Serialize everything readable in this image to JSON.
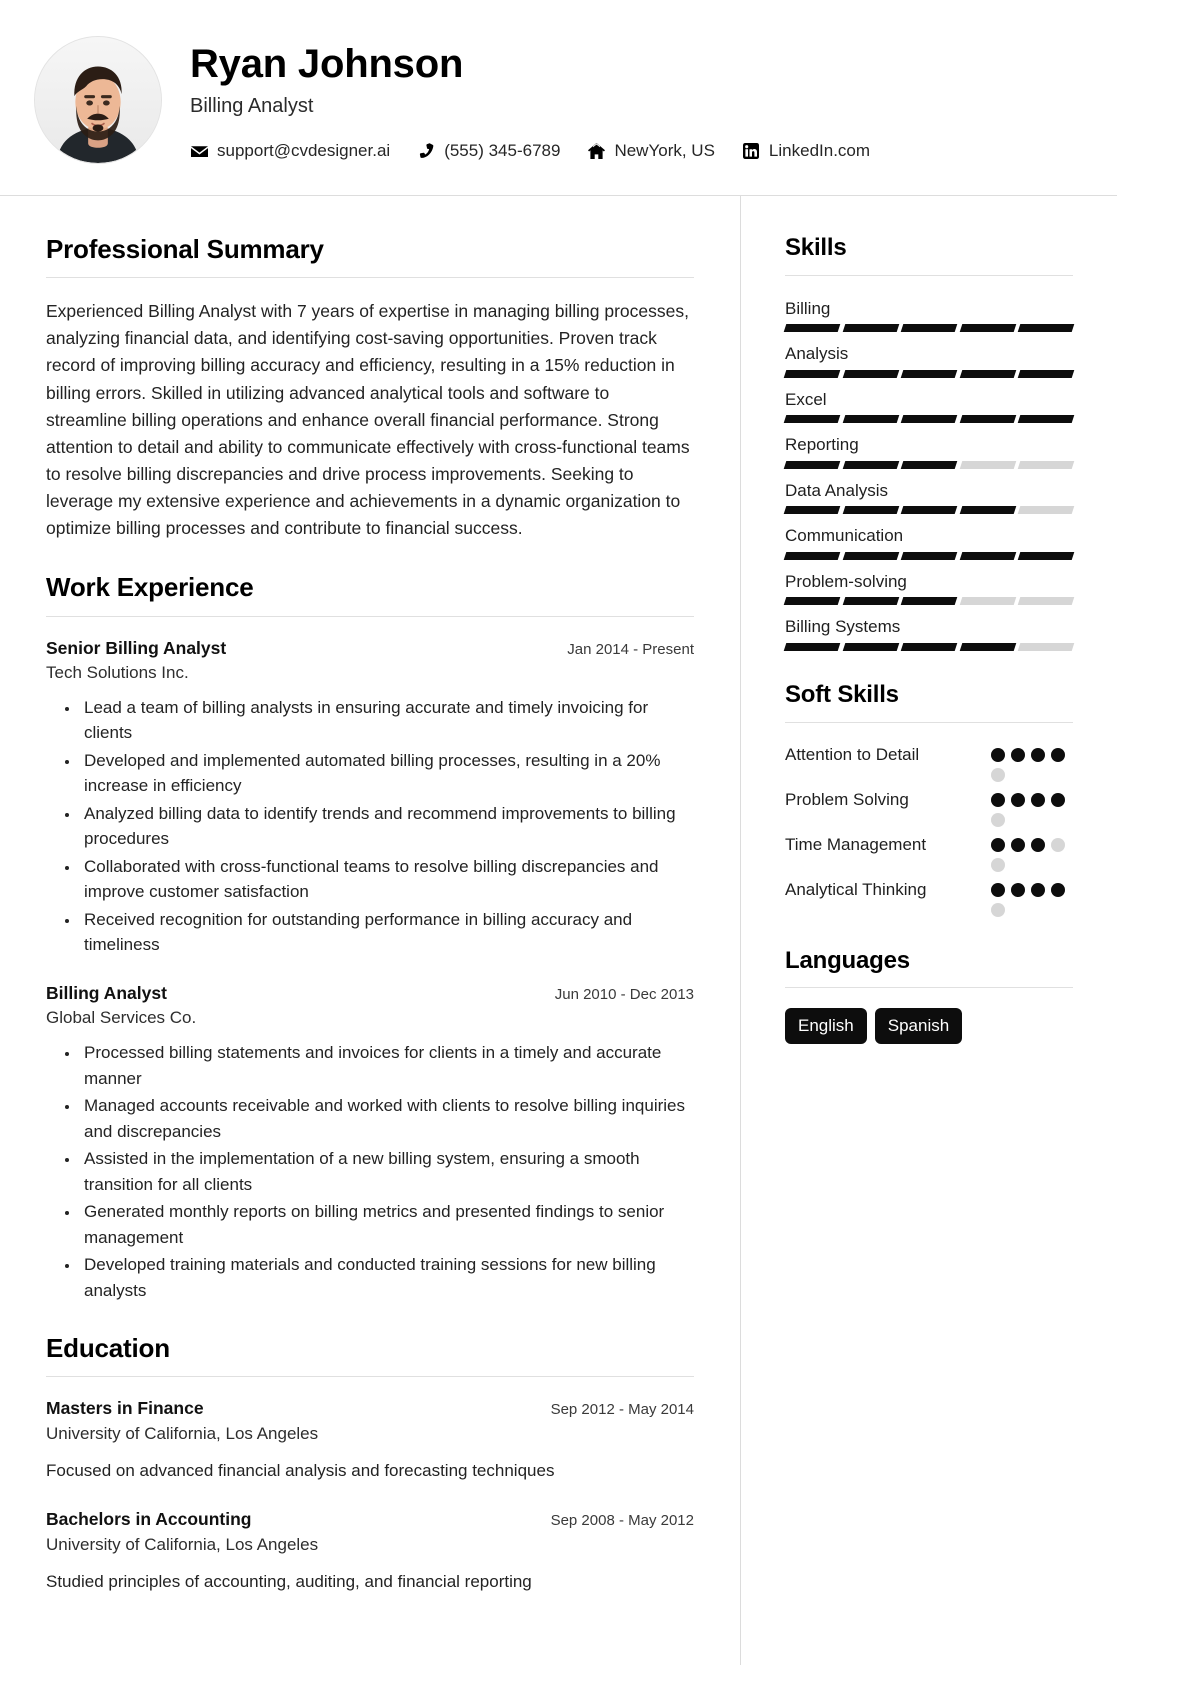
{
  "header": {
    "name": "Ryan Johnson",
    "title": "Billing Analyst",
    "avatar_name": "profile-photo",
    "contacts": [
      {
        "icon": "email-icon",
        "value": "support@cvdesigner.ai"
      },
      {
        "icon": "phone-icon",
        "value": "(555) 345-6789"
      },
      {
        "icon": "home-icon",
        "value": "NewYork, US"
      },
      {
        "icon": "linkedin-icon",
        "value": "LinkedIn.com"
      }
    ]
  },
  "summary": {
    "title": "Professional Summary",
    "text": "Experienced Billing Analyst with 7 years of expertise in managing billing processes, analyzing financial data, and identifying cost-saving opportunities. Proven track record of improving billing accuracy and efficiency, resulting in a 15% reduction in billing errors. Skilled in utilizing advanced analytical tools and software to streamline billing operations and enhance overall financial performance. Strong attention to detail and ability to communicate effectively with cross-functional teams to resolve billing discrepancies and drive process improvements. Seeking to leverage my extensive experience and achievements in a dynamic organization to optimize billing processes and contribute to financial success."
  },
  "experience": {
    "title": "Work Experience",
    "entries": [
      {
        "role": "Senior Billing Analyst",
        "dates": "Jan 2014 - Present",
        "org": "Tech Solutions Inc.",
        "bullets": [
          "Lead a team of billing analysts in ensuring accurate and timely invoicing for clients",
          "Developed and implemented automated billing processes, resulting in a 20% increase in efficiency",
          "Analyzed billing data to identify trends and recommend improvements to billing procedures",
          "Collaborated with cross-functional teams to resolve billing discrepancies and improve customer satisfaction",
          "Received recognition for outstanding performance in billing accuracy and timeliness"
        ]
      },
      {
        "role": "Billing Analyst",
        "dates": "Jun 2010 - Dec 2013",
        "org": "Global Services Co.",
        "bullets": [
          "Processed billing statements and invoices for clients in a timely and accurate manner",
          "Managed accounts receivable and worked with clients to resolve billing inquiries and discrepancies",
          "Assisted in the implementation of a new billing system, ensuring a smooth transition for all clients",
          "Generated monthly reports on billing metrics and presented findings to senior management",
          "Developed training materials and conducted training sessions for new billing analysts"
        ]
      }
    ]
  },
  "education": {
    "title": "Education",
    "entries": [
      {
        "degree": "Masters in Finance",
        "dates": "Sep 2012 - May 2014",
        "school": "University of California, Los Angeles",
        "desc": "Focused on advanced financial analysis and forecasting techniques"
      },
      {
        "degree": "Bachelors in Accounting",
        "dates": "Sep 2008 - May 2012",
        "school": "University of California, Los Angeles",
        "desc": "Studied principles of accounting, auditing, and financial reporting"
      }
    ]
  },
  "skills": {
    "title": "Skills",
    "max": 5,
    "items": [
      {
        "name": "Billing",
        "level": 5
      },
      {
        "name": "Analysis",
        "level": 5
      },
      {
        "name": "Excel",
        "level": 5
      },
      {
        "name": "Reporting",
        "level": 3
      },
      {
        "name": "Data Analysis",
        "level": 4
      },
      {
        "name": "Communication",
        "level": 5
      },
      {
        "name": "Problem-solving",
        "level": 3
      },
      {
        "name": "Billing Systems",
        "level": 4
      }
    ]
  },
  "soft_skills": {
    "title": "Soft Skills",
    "max": 5,
    "items": [
      {
        "name": "Attention to Detail",
        "level": 4
      },
      {
        "name": "Problem Solving",
        "level": 4
      },
      {
        "name": "Time Management",
        "level": 3
      },
      {
        "name": "Analytical Thinking",
        "level": 4
      }
    ]
  },
  "languages": {
    "title": "Languages",
    "items": [
      "English",
      "Spanish"
    ]
  },
  "colors": {
    "accent": "#0d0d0d",
    "track": "#d6d6d6",
    "rule": "#e0e0e0",
    "divider": "#dcdcdc"
  }
}
